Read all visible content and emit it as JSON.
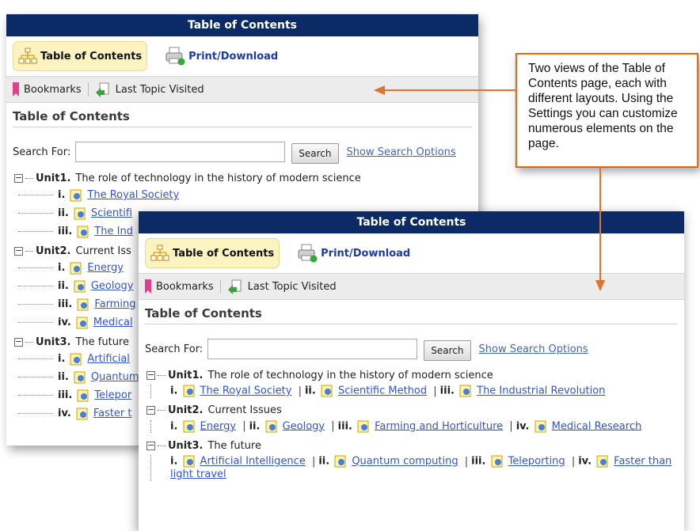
{
  "panel1": {
    "title": "Table of Contents",
    "toc_button": "Table of Contents",
    "print_button": "Print/Download",
    "bookmarks": "Bookmarks",
    "last_topic": "Last Topic Visited",
    "section_title": "Table of Contents",
    "search_label": "Search For:",
    "search_value": "",
    "search_button": "Search",
    "show_options": "Show Search Options",
    "units": [
      {
        "label": "Unit1.",
        "title": "The role of technology in the history of modern science",
        "topics": [
          {
            "num": "i.",
            "text": "The Royal Society"
          },
          {
            "num": "ii.",
            "text": "Scientifi"
          },
          {
            "num": "iii.",
            "text": "The Ind"
          }
        ]
      },
      {
        "label": "Unit2.",
        "title": "Current Iss",
        "topics": [
          {
            "num": "i.",
            "text": "Energy"
          },
          {
            "num": "ii.",
            "text": "Geology"
          },
          {
            "num": "iii.",
            "text": "Farming"
          },
          {
            "num": "iv.",
            "text": "Medical"
          }
        ]
      },
      {
        "label": "Unit3.",
        "title": "The future",
        "topics": [
          {
            "num": "i.",
            "text": "Artificial"
          },
          {
            "num": "ii.",
            "text": "Quantum"
          },
          {
            "num": "iii.",
            "text": "Telepor"
          },
          {
            "num": "iv.",
            "text": "Faster t"
          }
        ]
      }
    ]
  },
  "panel2": {
    "title": "Table of Contents",
    "toc_button": "Table of Contents",
    "print_button": "Print/Download",
    "bookmarks": "Bookmarks",
    "last_topic": "Last Topic Visited",
    "section_title": "Table of Contents",
    "search_label": "Search For:",
    "search_value": "",
    "search_button": "Search",
    "show_options": "Show Search Options",
    "separator": "|",
    "units": [
      {
        "label": "Unit1.",
        "title": "The role of technology in the history of modern science",
        "topics": [
          {
            "num": "i.",
            "text": "The Royal Society"
          },
          {
            "num": "ii.",
            "text": "Scientific Method"
          },
          {
            "num": "iii.",
            "text": "The Industrial Revolution"
          }
        ]
      },
      {
        "label": "Unit2.",
        "title": "Current Issues",
        "topics": [
          {
            "num": "i.",
            "text": "Energy"
          },
          {
            "num": "ii.",
            "text": "Geology"
          },
          {
            "num": "iii.",
            "text": "Farming and Horticulture"
          },
          {
            "num": "iv.",
            "text": "Medical Research"
          }
        ]
      },
      {
        "label": "Unit3.",
        "title": "The future",
        "topics": [
          {
            "num": "i.",
            "text": "Artificial Intelligence"
          },
          {
            "num": "ii.",
            "text": "Quantum computing"
          },
          {
            "num": "iii.",
            "text": "Teleporting"
          },
          {
            "num": "iv.",
            "text": "Faster than light travel"
          }
        ]
      }
    ]
  },
  "callout": {
    "text": "Two views of the Table of Contents page, each with different layouts. Using the Settings you can customize numerous elements on the page."
  },
  "colors": {
    "titlebar": "#0b2a66",
    "accent": "#f07a20",
    "link": "#3355cc"
  }
}
